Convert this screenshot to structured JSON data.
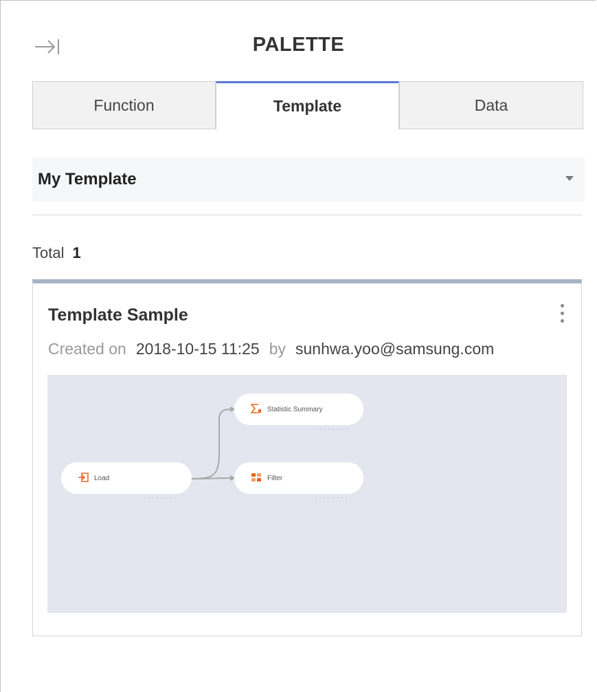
{
  "header": {
    "title": "PALETTE",
    "collapse_icon": "collapse-right-icon"
  },
  "tabs": [
    {
      "label": "Function",
      "active": false
    },
    {
      "label": "Template",
      "active": true
    },
    {
      "label": "Data",
      "active": false
    }
  ],
  "template_select": {
    "value": "My Template"
  },
  "summary": {
    "total_label": "Total",
    "total_count": "1"
  },
  "cards": [
    {
      "title": "Template Sample",
      "created_label": "Created on",
      "created_at": "2018-10-15 11:25",
      "by_label": "by",
      "author": "sunhwa.yoo@samsung.com",
      "preview": {
        "nodes": [
          {
            "label": "Load",
            "icon": "load-icon"
          },
          {
            "label": "Statistic Summary",
            "icon": "sigma-icon"
          },
          {
            "label": "Filter",
            "icon": "filter-icon"
          }
        ],
        "port_text": "- - - - - - - -"
      }
    }
  ],
  "colors": {
    "active_tab_border": "#5b76d9",
    "card_top_border": "#a9b3c6",
    "preview_bg": "#e3e6ee",
    "node_icon": "#e8661a"
  }
}
